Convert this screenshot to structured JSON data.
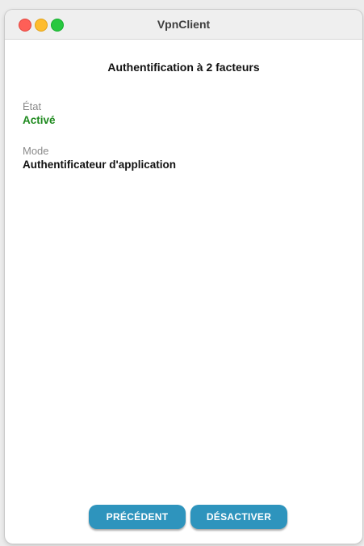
{
  "window": {
    "title": "VpnClient"
  },
  "page": {
    "title": "Authentification à 2 facteurs"
  },
  "fields": {
    "etat": {
      "label": "État",
      "value": "Activé",
      "value_color": "#1e8a1e"
    },
    "mode": {
      "label": "Mode",
      "value": "Authentificateur d'application"
    }
  },
  "buttons": {
    "previous": "PRÉCÉDENT",
    "deactivate": "DÉSACTIVER",
    "color": "#2e94bd"
  },
  "traffic_lights": {
    "close_color": "#fe5f57",
    "minimize_color": "#febc2e",
    "maximize_color": "#28c840"
  }
}
